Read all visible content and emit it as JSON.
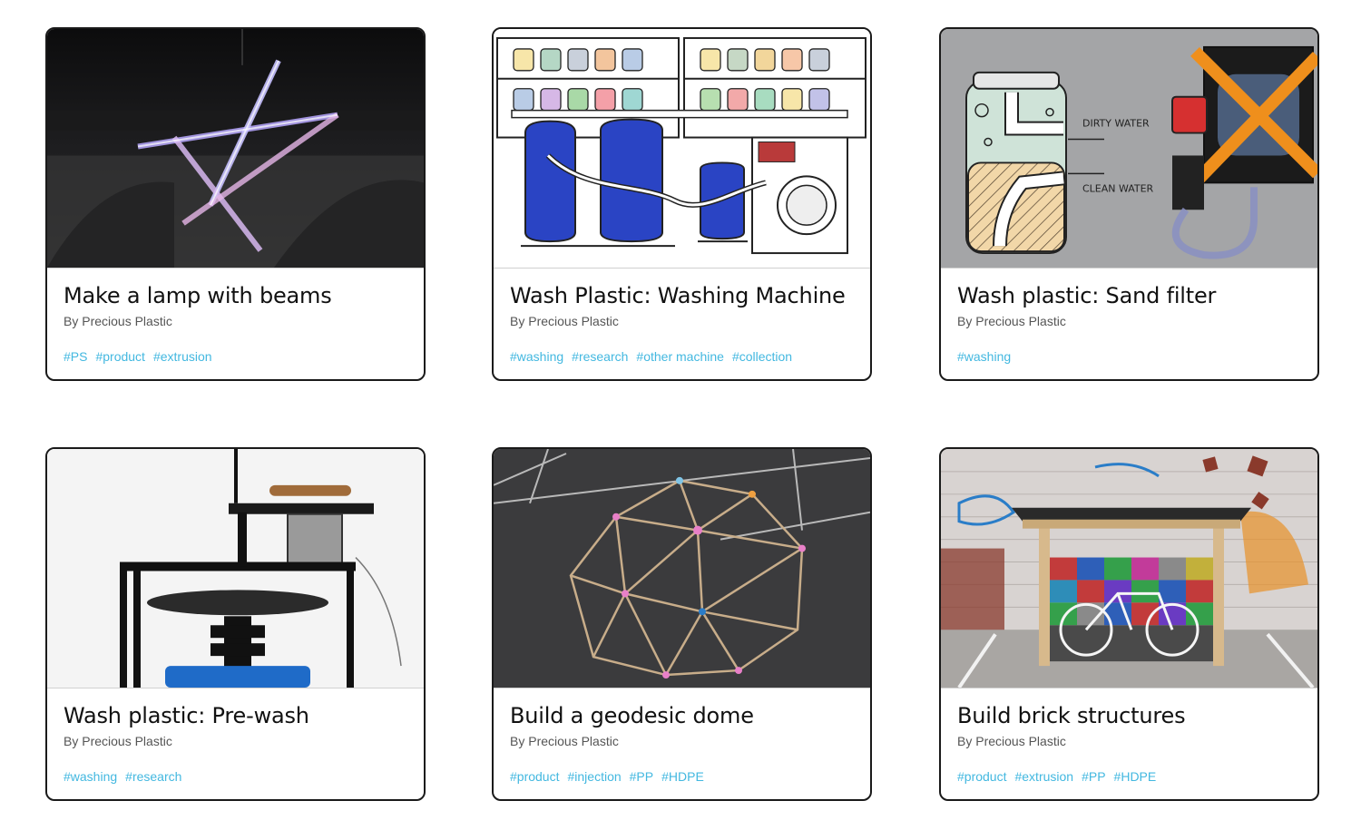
{
  "accent_color": "#43b8e0",
  "cards": [
    {
      "title": "Make a lamp with beams",
      "author": "By Precious Plastic",
      "tags": [
        "#PS",
        "#product",
        "#extrusion"
      ],
      "image": "lamp-photo"
    },
    {
      "title": "Wash Plastic: Washing Machine",
      "author": "By Precious Plastic",
      "tags": [
        "#washing",
        "#research",
        "#other machine",
        "#collection"
      ],
      "image": "washing-machine-illustration"
    },
    {
      "title": "Wash plastic: Sand filter",
      "author": "By Precious Plastic",
      "tags": [
        "#washing"
      ],
      "image": "sand-filter-photo",
      "image_labels": {
        "dirty": "DIRTY WATER",
        "clean": "CLEAN WATER"
      }
    },
    {
      "title": "Wash plastic: Pre-wash",
      "author": "By Precious Plastic",
      "tags": [
        "#washing",
        "#research"
      ],
      "image": "pre-wash-machine-photo"
    },
    {
      "title": "Build a geodesic dome",
      "author": "By Precious Plastic",
      "tags": [
        "#product",
        "#injection",
        "#PP",
        "#HDPE"
      ],
      "image": "geodesic-dome-photo"
    },
    {
      "title": "Build brick structures",
      "author": "By Precious Plastic",
      "tags": [
        "#product",
        "#extrusion",
        "#PP",
        "#HDPE"
      ],
      "image": "brick-shelter-photo"
    }
  ]
}
